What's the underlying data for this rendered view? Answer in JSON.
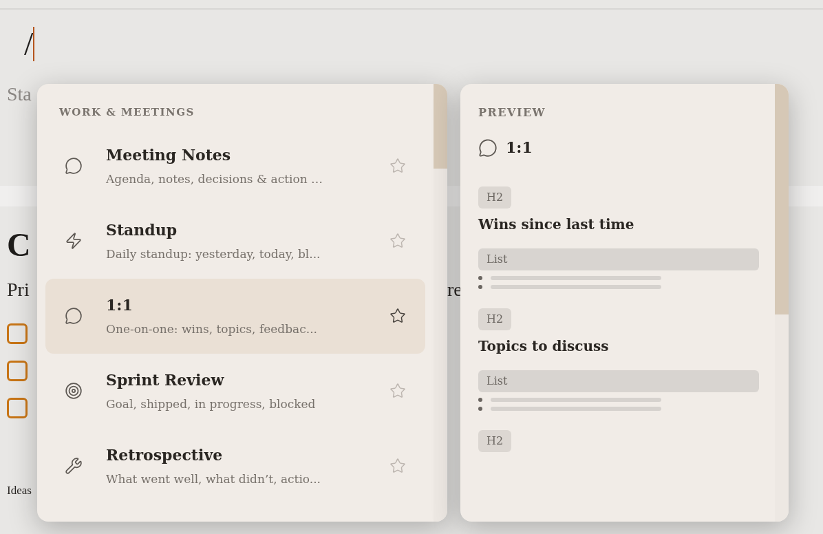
{
  "editor": {
    "command": "/",
    "subtitle": "Sta",
    "heading": "C",
    "paragraph": "Pri",
    "paragraph_end": "re",
    "checkboxes": [
      {
        "checked": false
      },
      {
        "checked": false
      },
      {
        "checked": false
      }
    ],
    "footer": "Ideas"
  },
  "menu": {
    "section": "WORK & MEETINGS",
    "items": [
      {
        "title": "Meeting Notes",
        "description": "Agenda, notes, decisions & action …",
        "selected": false
      },
      {
        "title": "Standup",
        "description": "Daily standup: yesterday, today, bl...",
        "selected": false
      },
      {
        "title": "1:1",
        "description": "One-on-one: wins, topics, feedbac...",
        "selected": true
      },
      {
        "title": "Sprint Review",
        "description": "Goal, shipped, in progress, blocked",
        "selected": false
      },
      {
        "title": "Retrospective",
        "description": "What went well, what didn’t, actio...",
        "selected": false
      }
    ]
  },
  "preview": {
    "label": "PREVIEW",
    "title": "1:1",
    "blocks": [
      {
        "kind": "heading",
        "badge": "H2",
        "text": "Wins since last time"
      },
      {
        "kind": "list",
        "badge": "List"
      },
      {
        "kind": "heading",
        "badge": "H2",
        "text": "Topics to discuss"
      },
      {
        "kind": "list",
        "badge": "List"
      },
      {
        "kind": "heading",
        "badge": "H2"
      }
    ]
  }
}
